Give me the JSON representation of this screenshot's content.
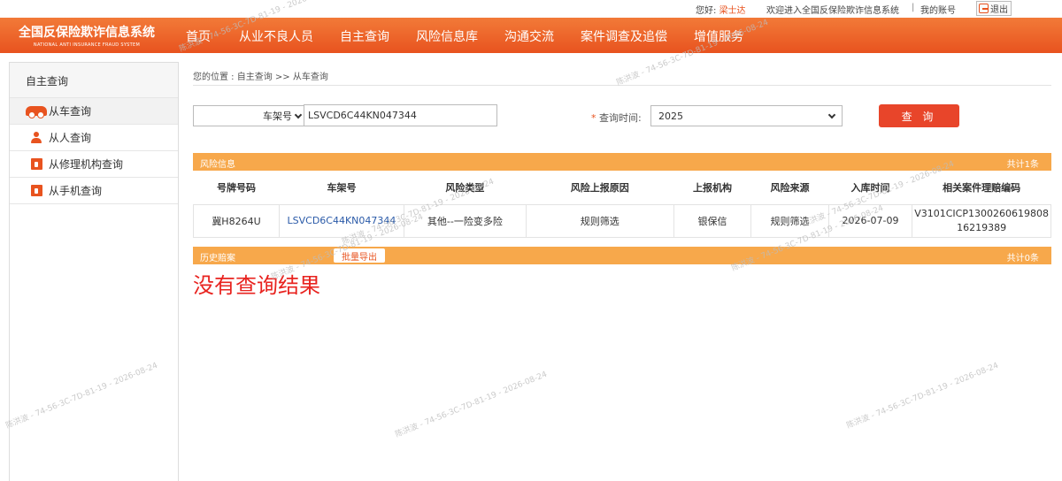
{
  "topbar": {
    "greeting_prefix": "您好:",
    "user_name": "梁士达",
    "welcome": "欢迎进入全国反保险欺诈信息系统",
    "separator": "|",
    "my_account": "我的账号",
    "logout": "退出"
  },
  "logo": {
    "cn": "全国反保险欺诈信息系统",
    "en": "NATIONAL ANTI INSURANCE FRAUD SYSTEM"
  },
  "nav": [
    "首页",
    "从业不良人员",
    "自主查询",
    "风险信息库",
    "沟通交流",
    "案件调查及追偿",
    "增值服务"
  ],
  "sidebar": {
    "title": "自主查询",
    "items": [
      {
        "label": "从车查询",
        "icon": "car-icon"
      },
      {
        "label": "从人查询",
        "icon": "person-icon"
      },
      {
        "label": "从修理机构查询",
        "icon": "repair-shop-icon"
      },
      {
        "label": "从手机查询",
        "icon": "phone-icon"
      }
    ]
  },
  "breadcrumb": "您的位置 : 自主查询 >> 从车查询",
  "search": {
    "type_selected": "车架号",
    "vin_value": "LSVCD6C44KN047344",
    "time_label_required": "*",
    "time_label": "查询时间:",
    "year_selected": "2025",
    "query_button": "查 询"
  },
  "risk_section": {
    "title": "风险信息",
    "count": "共计1条",
    "columns": [
      "号牌号码",
      "车架号",
      "风险类型",
      "风险上报原因",
      "上报机构",
      "风险来源",
      "入库时间",
      "相关案件理赔编码"
    ],
    "rows": [
      {
        "plate": "冀H8264U",
        "vin": "LSVCD6C44KN047344",
        "risk_type": "其他--一险变多险",
        "reason": "规则筛选",
        "org": "银保信",
        "source": "规则筛选",
        "date": "2026-07-09",
        "claim_code": "V3101CICP1300260619808 16219389"
      }
    ]
  },
  "history_section": {
    "title": "历史赔案",
    "export_button": "批量导出",
    "count": "共计0条"
  },
  "no_result": "没有查询结果",
  "watermark": "陈洪波 - 74-56-3C-7D-81-19 - 2026-08-24",
  "colors": {
    "accent": "#e8531f",
    "section_bar": "#f7a84b",
    "query_button": "#e8452a",
    "no_result": "#e8231f",
    "link": "#2a5aa8"
  }
}
